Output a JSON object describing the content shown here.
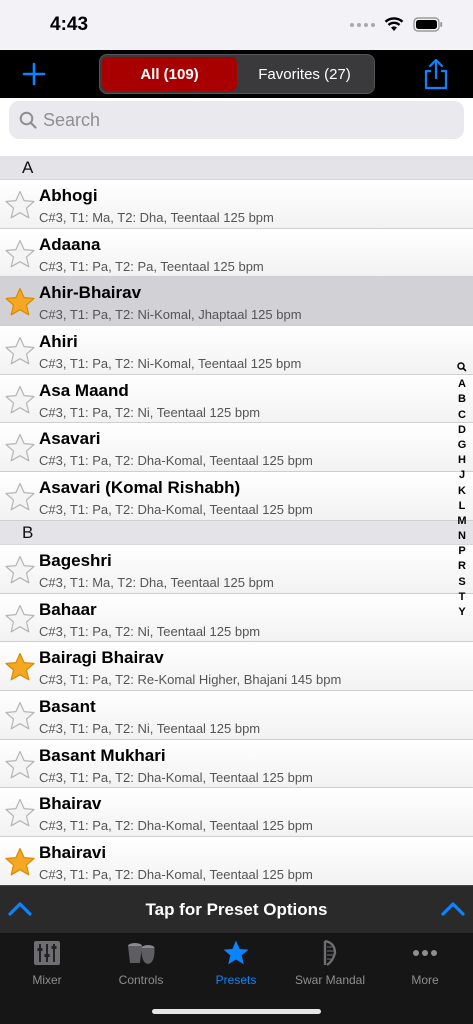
{
  "status": {
    "time": "4:43"
  },
  "toolbar": {
    "add_icon": "plus-icon",
    "segments": [
      {
        "label": "All (109)",
        "active": true
      },
      {
        "label": "Favorites (27)",
        "active": false
      }
    ],
    "share_icon": "share-icon"
  },
  "search": {
    "placeholder": "Search"
  },
  "sections": [
    {
      "letter": "A",
      "rows": [
        {
          "name": "Abhogi",
          "detail": "C#3, T1: Ma, T2: Dha, Teentaal 125 bpm",
          "favorite": false,
          "selected": false
        },
        {
          "name": "Adaana",
          "detail": "C#3, T1: Pa, T2: Pa, Teentaal 125 bpm",
          "favorite": false,
          "selected": false
        },
        {
          "name": "Ahir-Bhairav",
          "detail": "C#3, T1: Pa, T2: Ni-Komal, Jhaptaal 125 bpm",
          "favorite": true,
          "selected": true
        },
        {
          "name": "Ahiri",
          "detail": "C#3, T1: Pa, T2: Ni-Komal, Teentaal 125 bpm",
          "favorite": false,
          "selected": false
        },
        {
          "name": "Asa Maand",
          "detail": "C#3, T1: Pa, T2: Ni, Teentaal 125 bpm",
          "favorite": false,
          "selected": false
        },
        {
          "name": "Asavari",
          "detail": "C#3, T1: Pa, T2: Dha-Komal, Teentaal 125 bpm",
          "favorite": false,
          "selected": false
        },
        {
          "name": "Asavari (Komal Rishabh)",
          "detail": "C#3, T1: Pa, T2: Dha-Komal, Teentaal 125 bpm",
          "favorite": false,
          "selected": false
        }
      ]
    },
    {
      "letter": "B",
      "rows": [
        {
          "name": "Bageshri",
          "detail": "C#3, T1: Ma, T2: Dha, Teentaal 125 bpm",
          "favorite": false,
          "selected": false
        },
        {
          "name": "Bahaar",
          "detail": "C#3, T1: Pa, T2: Ni, Teentaal 125 bpm",
          "favorite": false,
          "selected": false
        },
        {
          "name": "Bairagi Bhairav",
          "detail": "C#3, T1: Pa, T2: Re-Komal Higher, Bhajani 145 bpm",
          "favorite": true,
          "selected": false
        },
        {
          "name": "Basant",
          "detail": "C#3, T1: Pa, T2: Ni, Teentaal 125 bpm",
          "favorite": false,
          "selected": false
        },
        {
          "name": "Basant Mukhari",
          "detail": "C#3, T1: Pa, T2: Dha-Komal, Teentaal 125 bpm",
          "favorite": false,
          "selected": false
        },
        {
          "name": "Bhairav",
          "detail": "C#3, T1: Pa, T2: Dha-Komal, Teentaal 125 bpm",
          "favorite": false,
          "selected": false
        },
        {
          "name": "Bhairavi",
          "detail": "C#3, T1: Pa, T2: Dha-Komal, Teentaal 125 bpm",
          "favorite": true,
          "selected": false
        }
      ]
    }
  ],
  "index": [
    "search-icon",
    "A",
    "B",
    "C",
    "D",
    "G",
    "H",
    "J",
    "K",
    "L",
    "M",
    "N",
    "P",
    "R",
    "S",
    "T",
    "Y"
  ],
  "options_bar": {
    "label": "Tap for Preset Options",
    "icon": "chevron-up-icon"
  },
  "tabs": [
    {
      "label": "Mixer",
      "icon": "sliders-icon",
      "active": false
    },
    {
      "label": "Controls",
      "icon": "tabla-icon",
      "active": false
    },
    {
      "label": "Presets",
      "icon": "star-icon",
      "active": true
    },
    {
      "label": "Swar Mandal",
      "icon": "harp-icon",
      "active": false
    },
    {
      "label": "More",
      "icon": "ellipsis-icon",
      "active": false
    }
  ],
  "colors": {
    "accent": "#0a84ff",
    "segment_active": "#a80000",
    "favorite_star": "#f5a623"
  }
}
